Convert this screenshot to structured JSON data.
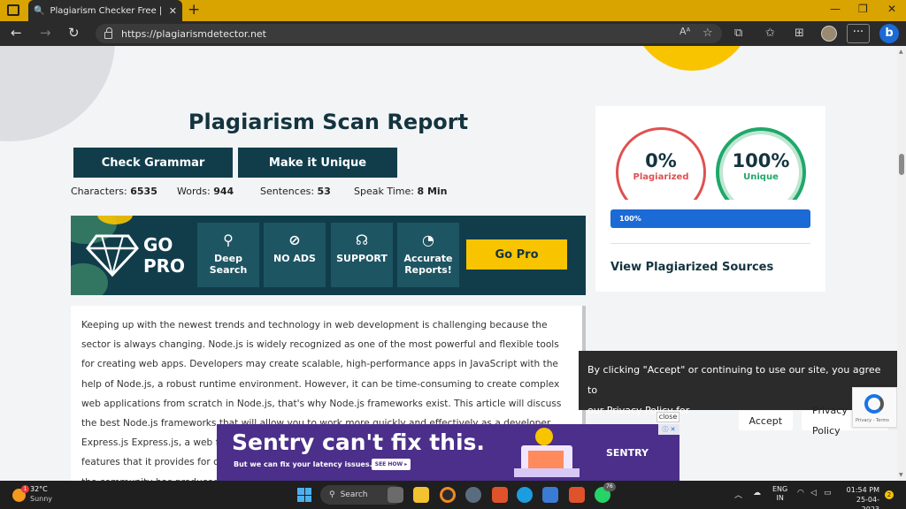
{
  "browser": {
    "tab_title": "Plagiarism Checker Free | Accura",
    "url": "https://plagiarismdetector.net",
    "read_aloud": "Aᴬ",
    "more": "···",
    "bing": "b"
  },
  "page": {
    "title": "Plagiarism Scan Report",
    "buttons": {
      "check_grammar": "Check Grammar",
      "make_unique": "Make it Unique"
    },
    "stats": [
      {
        "label": "Characters: ",
        "value": "6535"
      },
      {
        "label": "Words: ",
        "value": "944"
      },
      {
        "label": "Sentences: ",
        "value": "53"
      },
      {
        "label": "Speak Time: ",
        "value": "8 Min"
      }
    ],
    "gopro": {
      "line1": "GO",
      "line2": "PRO",
      "features": [
        {
          "icon": "magnifier-icon",
          "glyph": "⚲",
          "label": "Deep Search"
        },
        {
          "icon": "no-ads-icon",
          "glyph": "⊘",
          "label": "NO ADS"
        },
        {
          "icon": "headset-icon",
          "glyph": "☊",
          "label": "SUPPORT"
        },
        {
          "icon": "pie-chart-icon",
          "glyph": "◔",
          "label": "Accurate Reports!"
        }
      ],
      "button": "Go Pro"
    },
    "article": "Keeping up with the newest trends and technology in web development is challenging because the sector is always changing. Node.js is widely recognized as one of the most powerful and flexible tools for creating web apps. Developers may create scalable, high-performance apps in JavaScript with the help of Node.js, a robust runtime environment. However, it can be time-consuming to create complex web applications from scratch in Node.js, that's why Node.js frameworks exist. This article will discuss the best Node.js frameworks that will allow you to work more quickly and effectively as a developer. Express.js Express.js, a web framework for Node.js, is both minimal and flexible. It has a robust set of features that it provides for creating web applications and APIs. Thanks to its simplicity and flexibility, the community has produced many"
  },
  "results": {
    "plagiarized_value": "0%",
    "plagiarized_label": "Plagiarized",
    "unique_value": "100%",
    "unique_label": "Unique",
    "progress_fraction": 1.0,
    "progress_label": "100%",
    "sources_heading": "View Plagiarized Sources",
    "colors": {
      "plagiarized": "#e05050",
      "unique": "#1fa86a",
      "progress": "#1b6ad6"
    }
  },
  "cookie": {
    "text1": "By clicking \"Accept\" or continuing to use our site, you agree to",
    "text2": "our Privacy Policy for Website",
    "accept": "Accept",
    "privacy": "Privacy Policy"
  },
  "ad": {
    "close": "close",
    "headline": "Sentry can't fix this.",
    "sub": "But we can fix your latency issues.",
    "cta": "SEE HOW ▸",
    "logo": "SENTRY",
    "tag": "ⓘ ✕"
  },
  "recaptcha": {
    "text": "Privacy - Terms"
  },
  "taskbar": {
    "weather_temp": "32°C",
    "weather_desc": "Sunny",
    "weather_badge": "1",
    "search": "Search",
    "badge_whatsapp": "76",
    "lang1": "ENG",
    "lang2": "IN",
    "time": "01:54 PM",
    "date": "25-04-2023",
    "notifications": "2"
  }
}
